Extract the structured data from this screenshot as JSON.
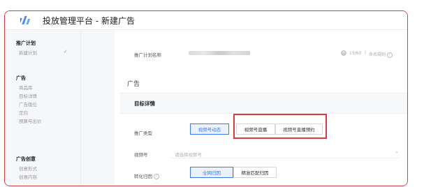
{
  "header": {
    "title": "投放管理平台 - 新建广告"
  },
  "sidebar": {
    "group1": "推广计划",
    "group1_items": [
      "新建计划"
    ],
    "group2": "广告",
    "group2_items": [
      "商品库",
      "目标详情",
      "广告版位",
      "定向",
      "预算与出价"
    ],
    "group3": "广告创意",
    "group3_items": [
      "创意形式",
      "创意内容"
    ]
  },
  "form": {
    "plan_name_label": "推广计划名称",
    "char_count": "15/60",
    "naming_rule": "命名规则",
    "section_title": "广告",
    "subsection_title": "目标详情",
    "promo_type_label": "推广类型",
    "promo_types": [
      "视频号动态",
      "视频号直播",
      "视频号直播预约"
    ],
    "channel_label": "视频号",
    "channel_placeholder": "请选择视频号",
    "conversion_label": "转化归因",
    "conversion_options": [
      "全网归因",
      "精准匹配归因"
    ]
  },
  "colors": {
    "accent": "#3a7bf5",
    "highlight": "#e0393e"
  }
}
